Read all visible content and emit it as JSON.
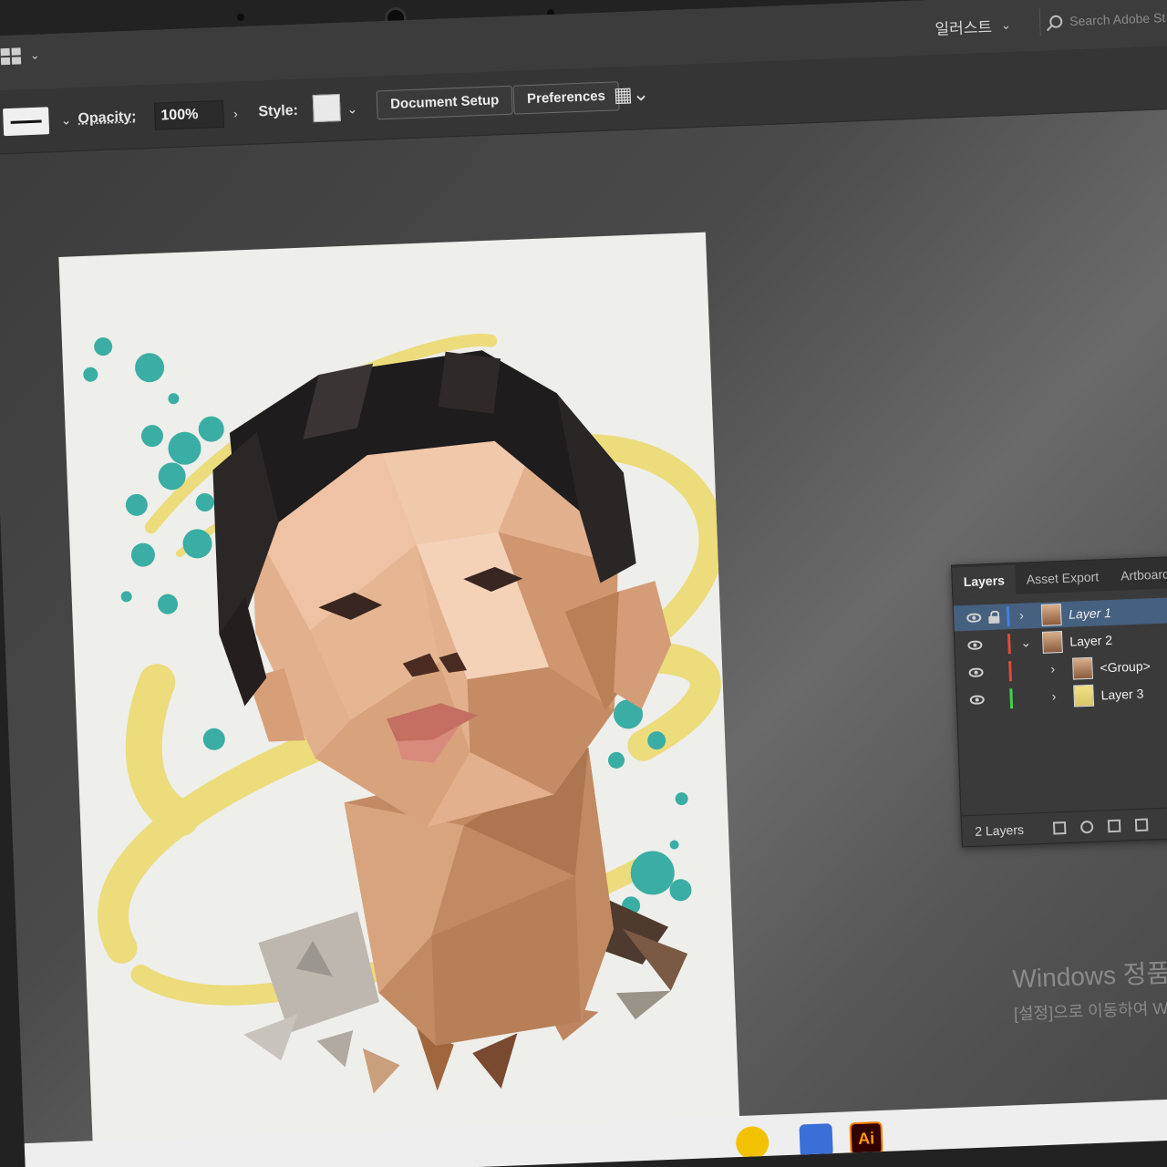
{
  "appbar": {
    "workspace_label": "일러스트",
    "search_placeholder": "Search Adobe St"
  },
  "controlbar": {
    "opacity_label": "Opacity:",
    "opacity_value": "100%",
    "style_label": "Style:",
    "document_setup_label": "Document Setup",
    "preferences_label": "Preferences"
  },
  "layers_panel": {
    "tabs": [
      "Layers",
      "Asset Export",
      "Artboards"
    ],
    "layers": [
      {
        "name": "Layer 1",
        "color": "#3f7fe0",
        "selected": true
      },
      {
        "name": "Layer 2",
        "color": "#e24a3a",
        "selected": false
      },
      {
        "name": "<Group>",
        "color": "#e24a3a",
        "selected": false
      },
      {
        "name": "Layer 3",
        "color": "#3fd24a",
        "selected": false
      }
    ],
    "count_label": "2 Layers"
  },
  "watermark": {
    "title": "Windows 정품 인",
    "subtitle": "[설정]으로 이동하여 W"
  },
  "taskbar": {
    "ai_label": "Ai"
  },
  "colors": {
    "artboard": "#eeeeea",
    "ring_yellow": "#ecdc7c",
    "splash_teal": "#3aaea4",
    "hair": "#1e1c1c",
    "skin_light": "#e9b896",
    "skin_mid": "#c98f66",
    "skin_dark": "#8c5a3c"
  }
}
